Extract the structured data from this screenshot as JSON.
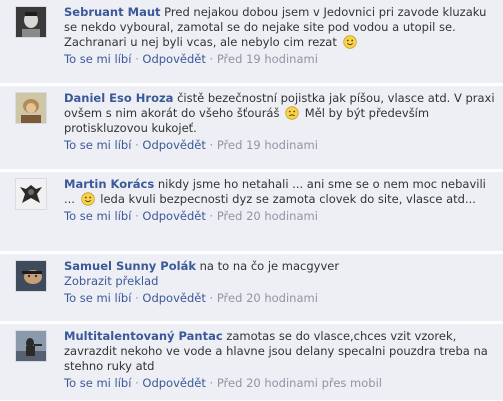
{
  "comments": [
    {
      "author": "Sebruant Maut",
      "text_before": "Pred nejakou dobou jsem v Jedovnici pri zavode kluzaku se nekdo vyboural, zamotal se do nejake site pod vodou a utopil se. Zachranari u nej byli vcas, ale nebylo cim rezat",
      "text_after": "",
      "like": "To se mi líbí",
      "reply": "Odpovědět",
      "dot": "·",
      "time": "Před 19 hodinami"
    },
    {
      "author": "Daniel Eso Hroza",
      "text_before": "čistě bezečnostní pojistka jak píšou, vlasce atd. V praxi ovšem s nim akorát do všeho šťouráš",
      "text_after": "Měl by být především protiskluzovou kukojeť.",
      "like": "To se mi líbí",
      "reply": "Odpovědět",
      "dot": "·",
      "time": "Před 19 hodinami"
    },
    {
      "author": "Martin Korács",
      "text_before": "nikdy jsme ho netahali ... ani sme se o nem moc nebavili ...",
      "text_after": "leda kvuli bezpecnosti dyz se zamota clovek do site, vlasce atd...",
      "like": "To se mi líbí",
      "reply": "Odpovědět",
      "dot": "·",
      "time": "Před 20 hodinami"
    },
    {
      "author": "Samuel Sunny Polák",
      "text_before": "na to na čo je macgyver",
      "translate": "Zobrazit překlad",
      "like": "To se mi líbí",
      "reply": "Odpovědět",
      "dot": "·",
      "time": "Před 20 hodinami"
    },
    {
      "author": "Multitalentovaný Pantac",
      "text_before": "zamotas se do vlasce,chces vzit vzorek, zavrazdit nekoho ve vode a hlavne jsou delany specalni pouzdra treba na stehno ruky atd",
      "like": "To se mi líbí",
      "reply": "Odpovědět",
      "dot": "·",
      "time": "Před 20 hodinami přes mobil"
    }
  ]
}
